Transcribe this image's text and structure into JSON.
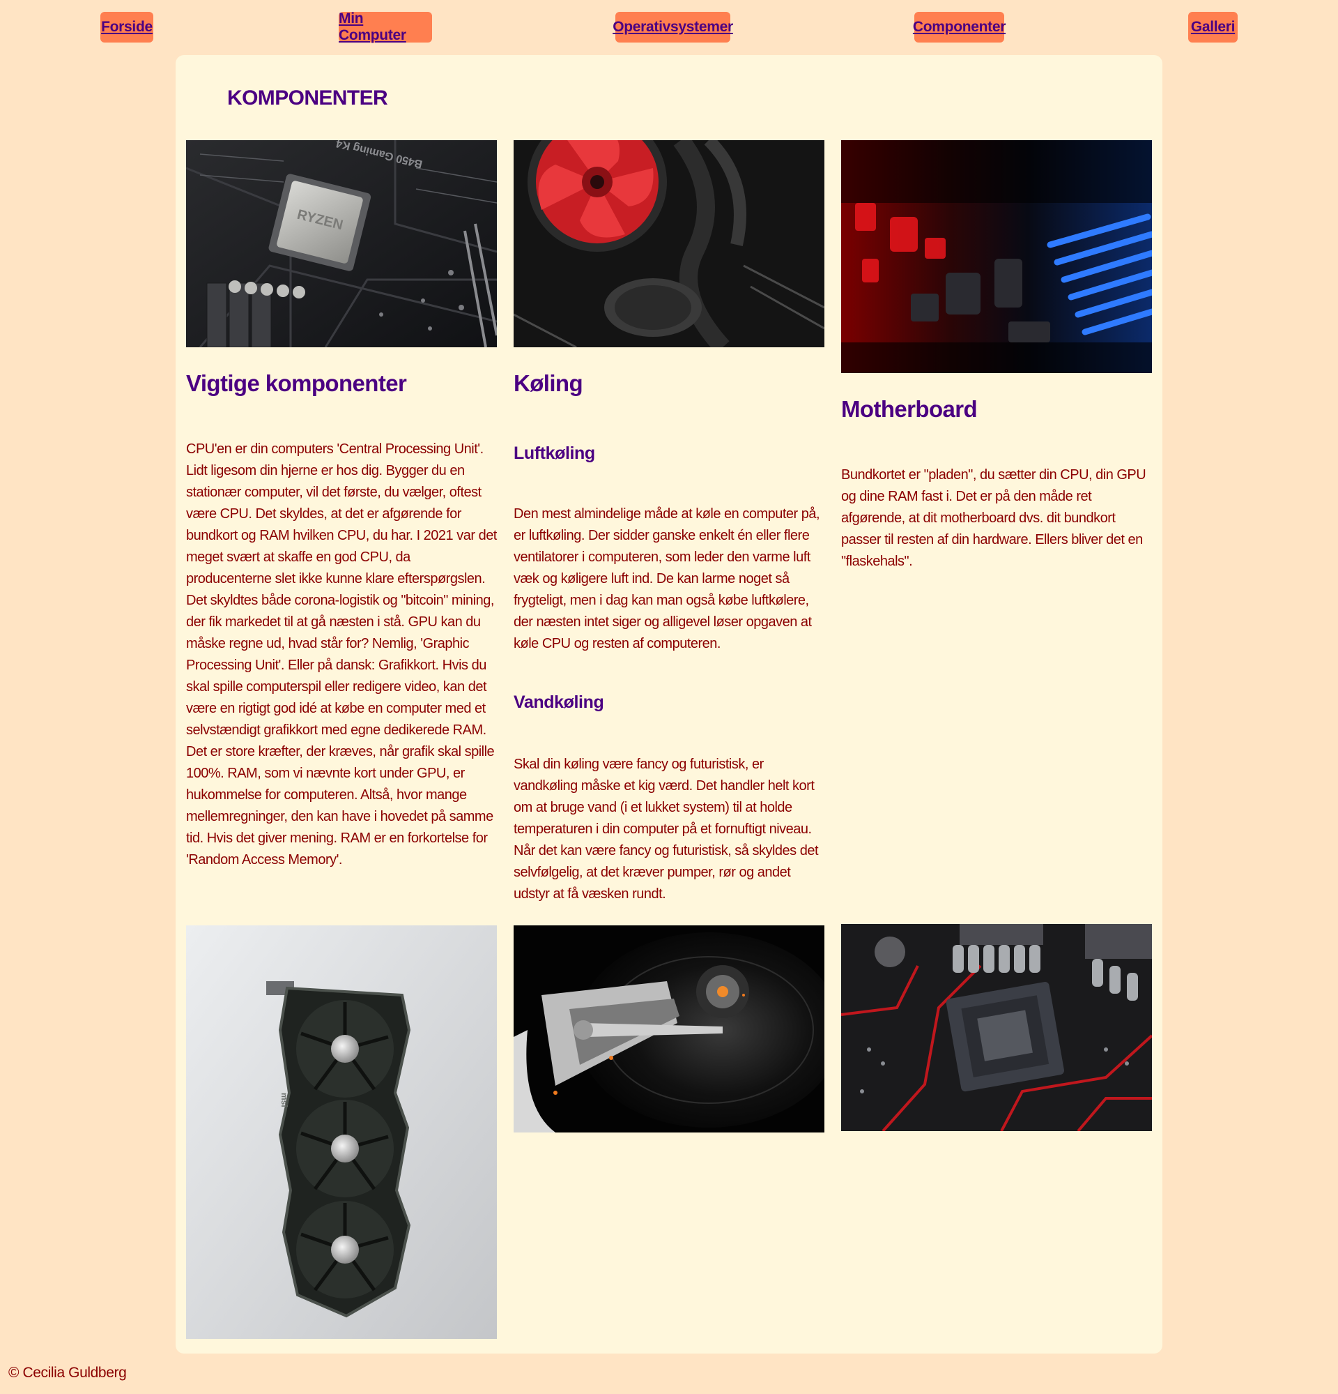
{
  "nav": {
    "items": [
      {
        "label": "Forside"
      },
      {
        "label": "Min Computer"
      },
      {
        "label": "Operativsystemer"
      },
      {
        "label": "Componenter"
      },
      {
        "label": "Galleri"
      }
    ]
  },
  "page": {
    "title": "KOMPONENTER"
  },
  "columns": {
    "components": {
      "heading": "Vigtige komponenter",
      "body": "CPU'en er din computers 'Central Processing Unit'. Lidt ligesom din hjerne er hos dig. Bygger du en stationær computer, vil det første, du vælger, oftest være CPU. Det skyldes, at det er afgørende for bundkort og RAM hvilken CPU, du har. I 2021 var det meget svært at skaffe en god CPU, da producenterne slet ikke kunne klare efterspørgslen. Det skyldtes både corona-logistik og \"bitcoin\" mining, der fik markedet til at gå næsten i stå. GPU kan du måske regne ud, hvad står for? Nemlig, 'Graphic Processing Unit'. Eller på dansk: Grafikkort. Hvis du skal spille computerspil eller redigere video, kan det være en rigtigt god idé at købe en computer med et selvstændigt grafikkort med egne dedikerede RAM. Det er store kræfter, der kræves, når grafik skal spille 100%. RAM, som vi nævnte kort under GPU, er hukommelse for computeren. Altså, hvor mange mellemregninger, den kan have i hovedet på samme tid. Hvis det giver mening. RAM er en forkortelse for 'Random Access Memory'."
    },
    "cooling": {
      "heading": "Køling",
      "air": {
        "heading": "Luftkøling",
        "body": "Den mest almindelige måde at køle en computer på, er luftkøling. Der sidder ganske enkelt én eller flere ventilatorer i computeren, som leder den varme luft væk og køligere luft ind. De kan larme noget så frygteligt, men i dag kan man også købe luftkølere, der næsten intet siger og alligevel løser opgaven at køle CPU og resten af computeren."
      },
      "water": {
        "heading": "Vandkøling",
        "body": "Skal din køling være fancy og futuristisk, er vandkøling måske et kig værd. Det handler helt kort om at bruge vand (i et lukket system) til at holde temperaturen i din computer på et fornuftigt niveau. Når det kan være fancy og futuristisk, så skyldes det selvfølgelig, at det kræver pumper, rør og andet udstyr at få væsken rundt."
      }
    },
    "motherboard": {
      "heading": "Motherboard",
      "body": "Bundkortet er \"pladen\", du sætter din CPU, din GPU og dine RAM fast i. Det er på den måde ret afgørende, at dit motherboard dvs. dit bundkort passer til resten af din hardware. Ellers bliver det en \"flaskehals\"."
    }
  },
  "photos": {
    "cpu_label": "RYZEN",
    "board_label": "B450 Gaming K4",
    "gpu_brand": "msi"
  },
  "footer": {
    "text": "© Cecilia Guldberg"
  },
  "colors": {
    "background": "#ffe4c4",
    "panel": "#fff7dc",
    "nav_button": "#ff7f50",
    "heading": "#4b0082",
    "body_text": "#8b0000"
  }
}
